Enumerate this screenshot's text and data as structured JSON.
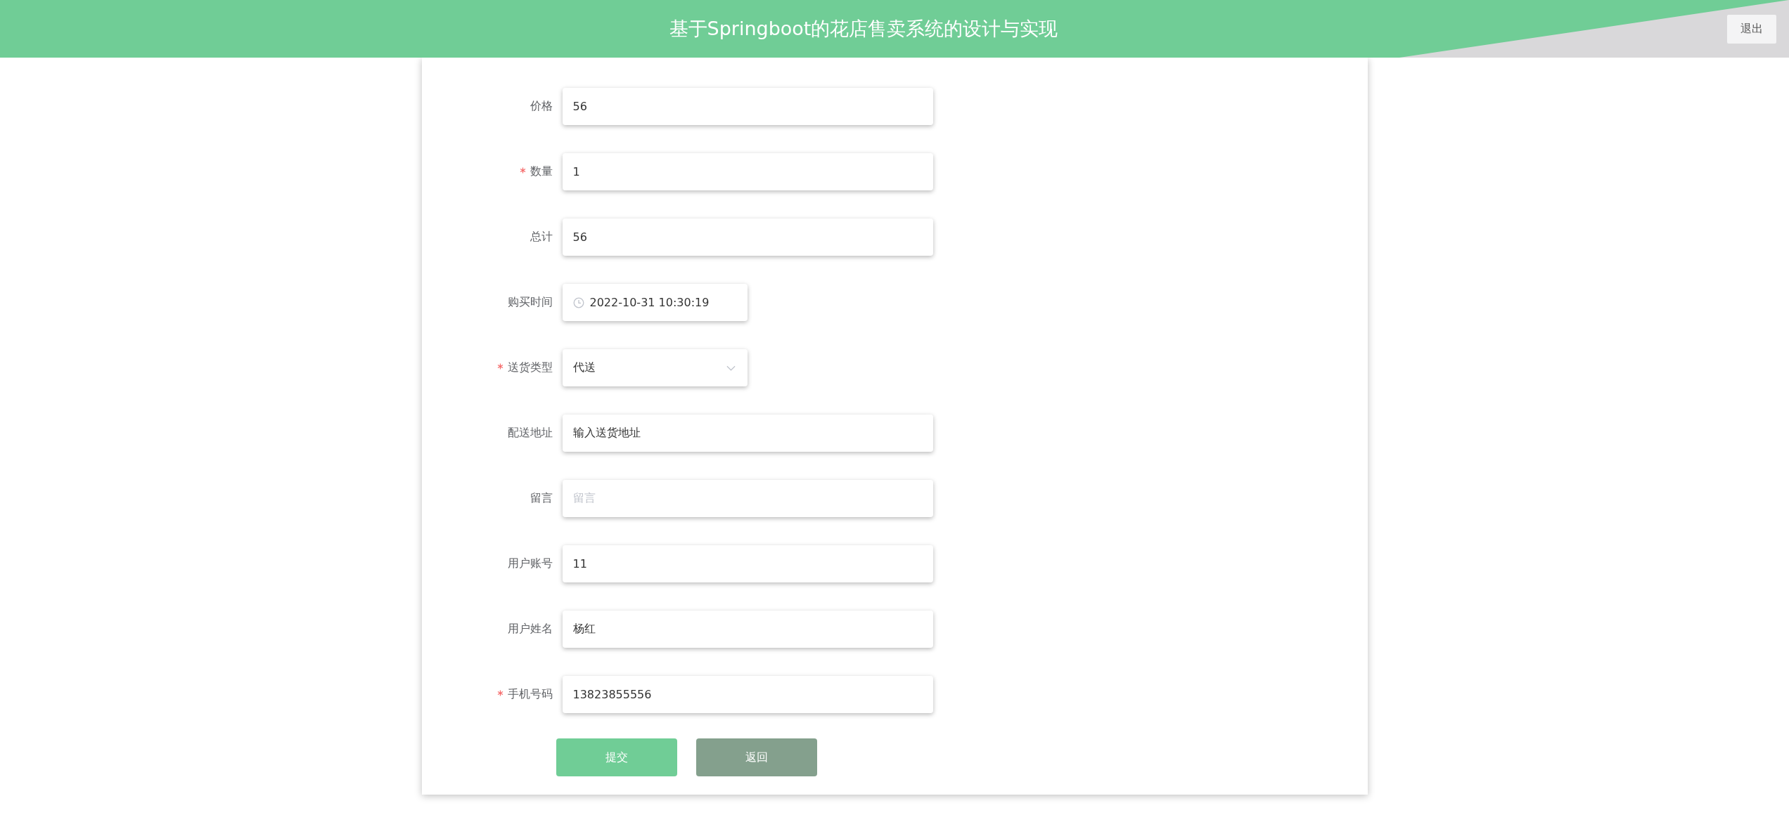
{
  "header": {
    "title": "基于Springboot的花店售卖系统的设计与实现",
    "logout_button": "退出"
  },
  "form": {
    "fields": [
      {
        "label": "价格",
        "required": false,
        "kind": "text",
        "value": "56"
      },
      {
        "label": "数量",
        "required": true,
        "kind": "text",
        "value": "1"
      },
      {
        "label": "总计",
        "required": false,
        "kind": "text",
        "value": "56"
      },
      {
        "label": "购买时间",
        "required": false,
        "kind": "datetime",
        "value": "2022-10-31 10:30:19"
      },
      {
        "label": "送货类型",
        "required": true,
        "kind": "select",
        "value": "代送"
      },
      {
        "label": "配送地址",
        "required": false,
        "kind": "text",
        "value": "输入送货地址"
      },
      {
        "label": "留言",
        "required": false,
        "kind": "text",
        "placeholder": "留言"
      },
      {
        "label": "用户账号",
        "required": false,
        "kind": "text",
        "value": "11"
      },
      {
        "label": "用户姓名",
        "required": false,
        "kind": "text",
        "value": "杨红"
      },
      {
        "label": "手机号码",
        "required": true,
        "kind": "text",
        "value": "13823855556"
      }
    ],
    "buttons": [
      {
        "label": "提交",
        "kind": "primary"
      },
      {
        "label": "返回",
        "kind": "secondary"
      }
    ]
  }
}
